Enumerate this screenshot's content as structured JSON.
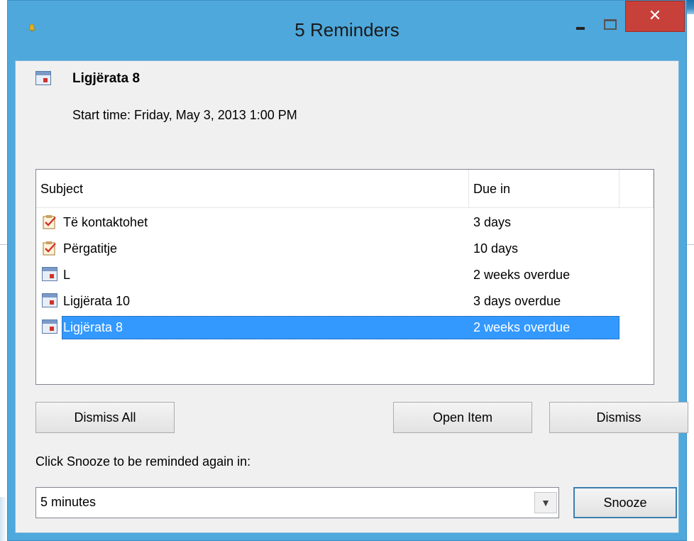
{
  "window": {
    "title": "5 Reminders",
    "close_glyph": "✕"
  },
  "header": {
    "subject": "Ligjërata 8",
    "start_time": "Start time: Friday, May 3, 2013 1:00 PM"
  },
  "list": {
    "columns": [
      "Subject",
      "Due in"
    ],
    "rows": [
      {
        "icon": "task-icon",
        "subject": "Të kontaktohet",
        "due": "3 days"
      },
      {
        "icon": "task-icon",
        "subject": "Përgatitje",
        "due": "10 days"
      },
      {
        "icon": "calendar-icon",
        "subject": "L",
        "due": "2 weeks overdue"
      },
      {
        "icon": "calendar-icon",
        "subject": "Ligjërata 10",
        "due": "3 days overdue"
      },
      {
        "icon": "calendar-icon",
        "subject": "Ligjërata 8",
        "due": "2 weeks overdue",
        "selected": true
      }
    ]
  },
  "buttons": {
    "dismiss_all": "Dismiss All",
    "open_item": "Open Item",
    "dismiss": "Dismiss",
    "snooze": "Snooze"
  },
  "snooze": {
    "label": "Click Snooze to be reminded again in:",
    "selected": "5 minutes",
    "arrow_glyph": "▼"
  },
  "colors": {
    "frame": "#4ea8dc",
    "close": "#c7413a",
    "selection": "#3399ff"
  }
}
